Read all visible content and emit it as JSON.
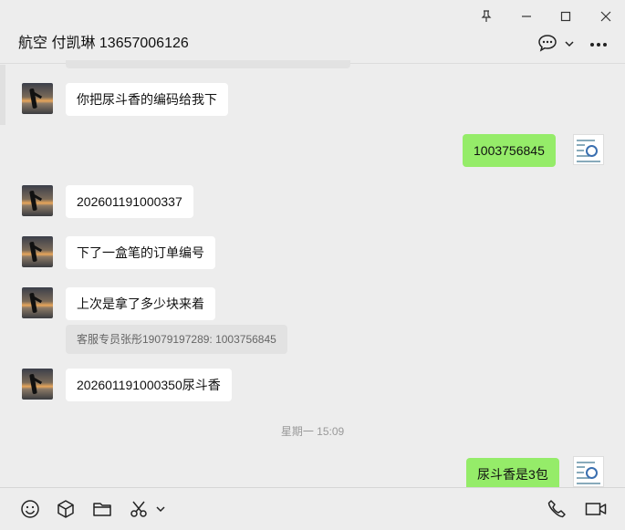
{
  "header": {
    "title": "航空 付凯琳 13657006126",
    "icons": [
      "pin-icon",
      "minimize-icon",
      "maximize-icon",
      "close-icon",
      "chat-bubble-icon",
      "chevron-down-icon",
      "more-icon"
    ]
  },
  "messages": [
    {
      "side": "in",
      "text": "你把尿斗香的编码给我下"
    },
    {
      "side": "out",
      "text": "1003756845"
    },
    {
      "side": "in",
      "text": "202601191000337"
    },
    {
      "side": "in",
      "text": "下了一盒笔的订单编号"
    },
    {
      "side": "in",
      "text": "上次是拿了多少块来着",
      "quote": "客服专员张彤19079197289: 1003756845"
    },
    {
      "side": "in",
      "text": "202601191000350尿斗香"
    },
    {
      "timestamp": "星期一 15:09"
    },
    {
      "side": "out",
      "text": "尿斗香是3包"
    }
  ],
  "toolbar": {
    "icons": [
      "emoji-icon",
      "package-icon",
      "folder-icon",
      "scissors-icon",
      "chevron-down-icon",
      "phone-icon",
      "video-icon"
    ]
  },
  "colors": {
    "bg": "#ededed",
    "outgoing": "#95ec69",
    "incoming": "#ffffff"
  }
}
